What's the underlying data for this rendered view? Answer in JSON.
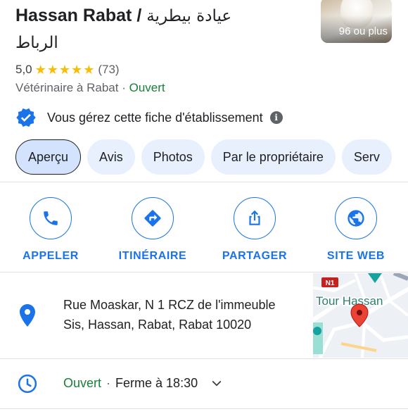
{
  "header": {
    "name": "Hassan Rabat",
    "separator": "/",
    "arabic_line1": "عيادة بيطرية",
    "arabic_line2": "الرباط",
    "photo_count_label": "96 ou plus"
  },
  "rating": {
    "value": "5,0",
    "stars": "★★★★★",
    "stars_count": 5,
    "reviews": "(73)"
  },
  "category": {
    "text": "Vétérinaire à Rabat",
    "separator": "·",
    "status": "Ouvert"
  },
  "ownership": {
    "text": "Vous gérez cette fiche d'établissement",
    "info_glyph": "i"
  },
  "tabs": [
    {
      "label": "Aperçu",
      "active": true
    },
    {
      "label": "Avis",
      "active": false
    },
    {
      "label": "Photos",
      "active": false
    },
    {
      "label": "Par le propriétaire",
      "active": false
    },
    {
      "label": "Serv",
      "active": false
    }
  ],
  "actions": [
    {
      "label": "APPELER",
      "icon": "phone-icon"
    },
    {
      "label": "ITINÉRAIRE",
      "icon": "directions-icon"
    },
    {
      "label": "PARTAGER",
      "icon": "share-icon"
    },
    {
      "label": "SITE WEB",
      "icon": "globe-icon"
    }
  ],
  "address": {
    "line1": "Rue Moaskar, N 1 RCZ de l'immeuble",
    "line2": "Sis, Hassan, Rabat, Rabat 10020"
  },
  "map": {
    "road_label": "N1",
    "place_label": "Tour Hassan"
  },
  "hours": {
    "status": "Ouvert",
    "separator": "·",
    "closing": "Ferme à 18:30"
  },
  "colors": {
    "accent_blue": "#1a73e8",
    "open_green": "#188038",
    "star_yellow": "#fbbc04",
    "chip_bg": "#e8f0fe",
    "pin_blue": "#1a73e8",
    "map_pin_red": "#ea4335"
  }
}
